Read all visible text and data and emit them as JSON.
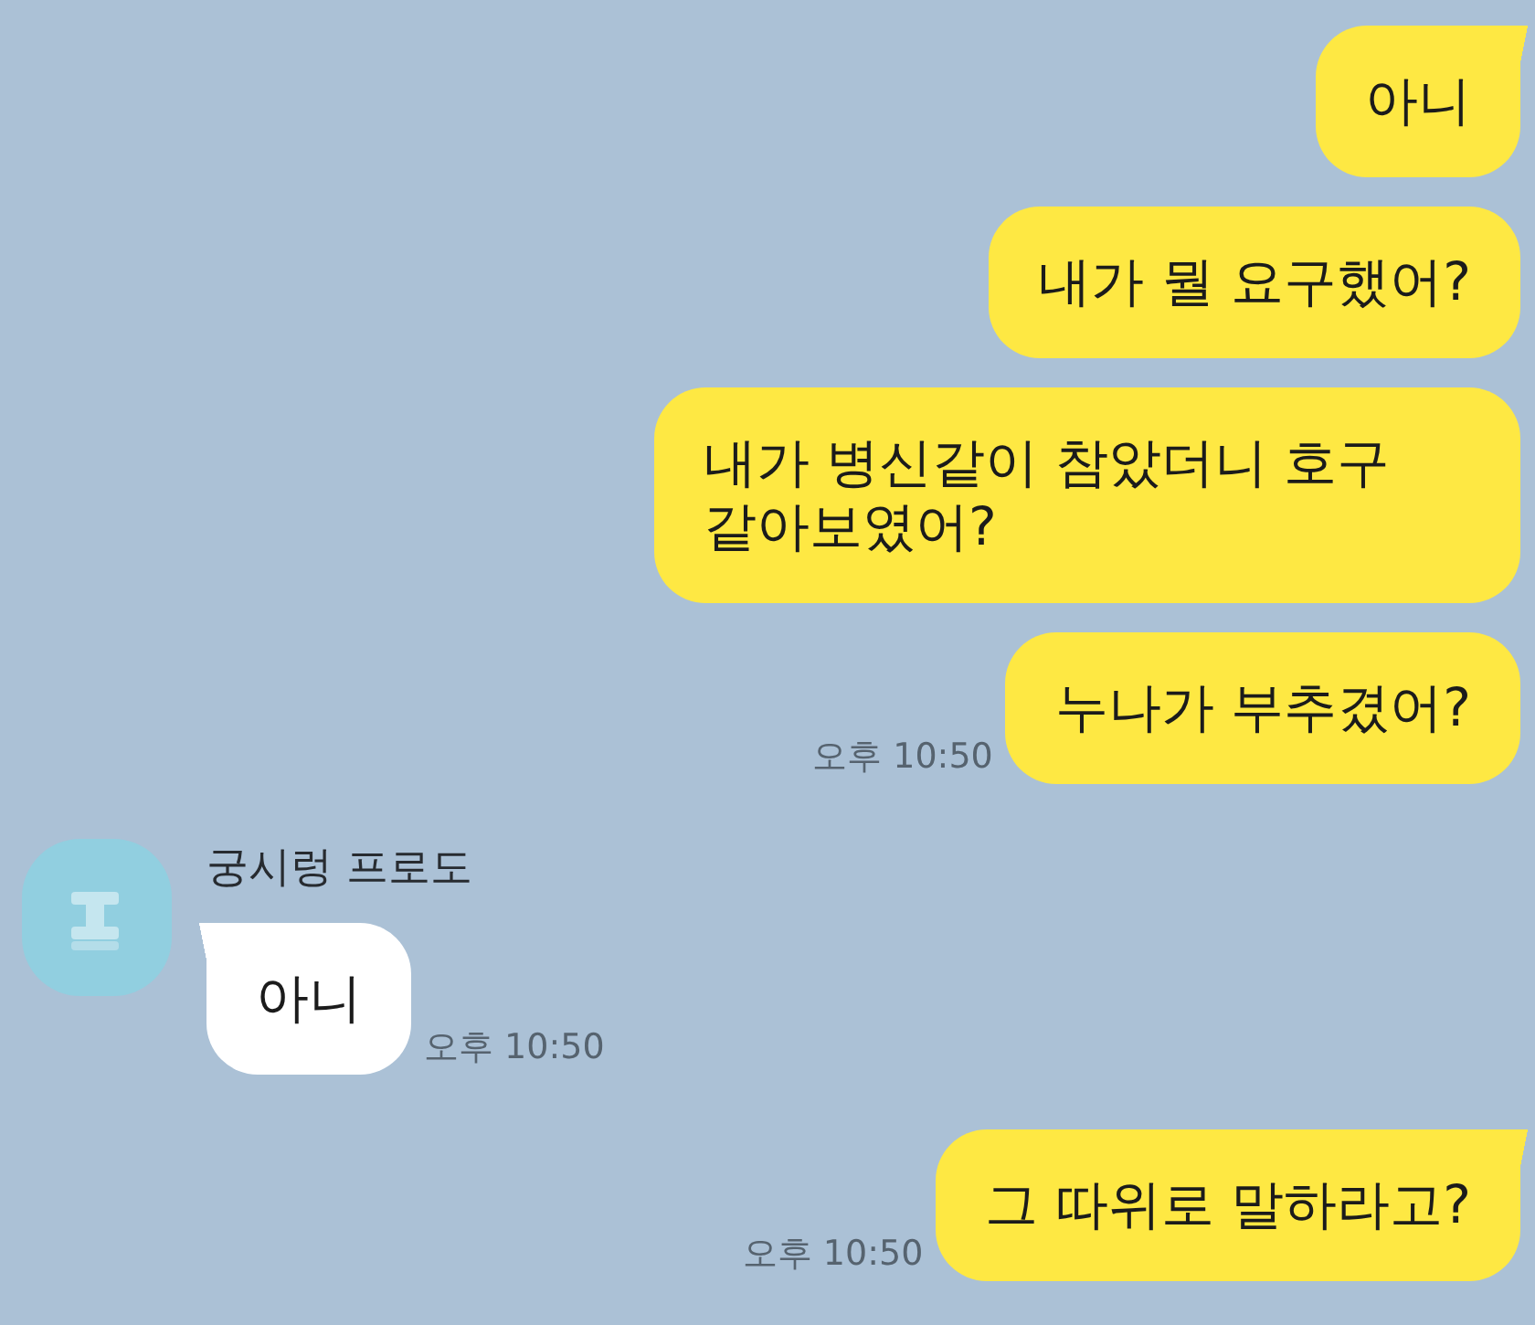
{
  "chat": {
    "groups": [
      {
        "kind": "outgoing",
        "messages": [
          "아니",
          "내가 뭘 요구했어?",
          "내가 병신같이 참았더니 호구 같아보였어?",
          "누나가 부추겼어?"
        ],
        "time": "오후 10:50"
      },
      {
        "kind": "incoming",
        "sender": "궁시렁 프로도",
        "messages": [
          "아니"
        ],
        "time": "오후 10:50"
      },
      {
        "kind": "outgoing",
        "messages": [
          "그 따위로 말하라고?"
        ],
        "time": "오후 10:50"
      }
    ]
  }
}
